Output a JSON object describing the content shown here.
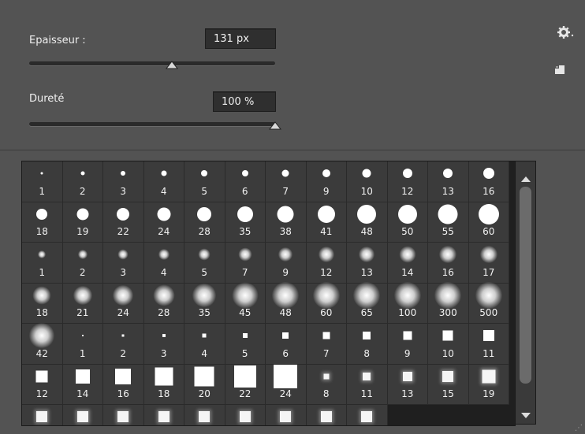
{
  "size": {
    "label": "Epaisseur :",
    "value": "131 px",
    "slider_percent": 58
  },
  "hardness": {
    "label": "Dureté",
    "value": "100 %",
    "slider_percent": 100
  },
  "icons": {
    "settings": "gear-icon",
    "new_preset": "new-preset-icon"
  },
  "brushes": [
    {
      "size": "1",
      "kind": "hard"
    },
    {
      "size": "2",
      "kind": "hard"
    },
    {
      "size": "3",
      "kind": "hard"
    },
    {
      "size": "4",
      "kind": "hard"
    },
    {
      "size": "5",
      "kind": "hard"
    },
    {
      "size": "6",
      "kind": "hard"
    },
    {
      "size": "7",
      "kind": "hard"
    },
    {
      "size": "9",
      "kind": "hard"
    },
    {
      "size": "10",
      "kind": "hard"
    },
    {
      "size": "12",
      "kind": "hard"
    },
    {
      "size": "13",
      "kind": "hard"
    },
    {
      "size": "16",
      "kind": "hard"
    },
    {
      "size": "18",
      "kind": "hard"
    },
    {
      "size": "19",
      "kind": "hard"
    },
    {
      "size": "22",
      "kind": "hard"
    },
    {
      "size": "24",
      "kind": "hard"
    },
    {
      "size": "28",
      "kind": "hard"
    },
    {
      "size": "35",
      "kind": "hard"
    },
    {
      "size": "38",
      "kind": "hard"
    },
    {
      "size": "41",
      "kind": "hard"
    },
    {
      "size": "48",
      "kind": "hard"
    },
    {
      "size": "50",
      "kind": "hard"
    },
    {
      "size": "55",
      "kind": "hard"
    },
    {
      "size": "60",
      "kind": "hard"
    },
    {
      "size": "1",
      "kind": "soft"
    },
    {
      "size": "2",
      "kind": "soft"
    },
    {
      "size": "3",
      "kind": "soft"
    },
    {
      "size": "4",
      "kind": "soft"
    },
    {
      "size": "5",
      "kind": "soft"
    },
    {
      "size": "7",
      "kind": "soft"
    },
    {
      "size": "9",
      "kind": "soft"
    },
    {
      "size": "12",
      "kind": "soft"
    },
    {
      "size": "13",
      "kind": "soft"
    },
    {
      "size": "14",
      "kind": "soft"
    },
    {
      "size": "16",
      "kind": "soft"
    },
    {
      "size": "17",
      "kind": "soft"
    },
    {
      "size": "18",
      "kind": "soft"
    },
    {
      "size": "21",
      "kind": "soft"
    },
    {
      "size": "24",
      "kind": "soft"
    },
    {
      "size": "28",
      "kind": "soft"
    },
    {
      "size": "35",
      "kind": "soft"
    },
    {
      "size": "45",
      "kind": "soft"
    },
    {
      "size": "48",
      "kind": "soft"
    },
    {
      "size": "60",
      "kind": "soft"
    },
    {
      "size": "65",
      "kind": "soft"
    },
    {
      "size": "100",
      "kind": "soft"
    },
    {
      "size": "300",
      "kind": "soft"
    },
    {
      "size": "500",
      "kind": "soft"
    },
    {
      "size": "42",
      "kind": "soft"
    },
    {
      "size": "1",
      "kind": "square"
    },
    {
      "size": "2",
      "kind": "square"
    },
    {
      "size": "3",
      "kind": "square"
    },
    {
      "size": "4",
      "kind": "square"
    },
    {
      "size": "5",
      "kind": "square"
    },
    {
      "size": "6",
      "kind": "square"
    },
    {
      "size": "7",
      "kind": "square"
    },
    {
      "size": "8",
      "kind": "square"
    },
    {
      "size": "9",
      "kind": "square"
    },
    {
      "size": "10",
      "kind": "square"
    },
    {
      "size": "11",
      "kind": "square"
    },
    {
      "size": "12",
      "kind": "square"
    },
    {
      "size": "14",
      "kind": "square"
    },
    {
      "size": "16",
      "kind": "square"
    },
    {
      "size": "18",
      "kind": "square"
    },
    {
      "size": "20",
      "kind": "square"
    },
    {
      "size": "22",
      "kind": "square"
    },
    {
      "size": "24",
      "kind": "square"
    },
    {
      "size": "8",
      "kind": "softsquare"
    },
    {
      "size": "11",
      "kind": "softsquare"
    },
    {
      "size": "13",
      "kind": "softsquare"
    },
    {
      "size": "15",
      "kind": "softsquare"
    },
    {
      "size": "19",
      "kind": "softsquare"
    },
    {
      "size": "",
      "kind": "softsquare"
    },
    {
      "size": "",
      "kind": "softsquare"
    },
    {
      "size": "",
      "kind": "softsquare"
    },
    {
      "size": "",
      "kind": "softsquare"
    },
    {
      "size": "",
      "kind": "softsquare"
    },
    {
      "size": "",
      "kind": "softsquare"
    },
    {
      "size": "",
      "kind": "softsquare"
    },
    {
      "size": "",
      "kind": "softsquare"
    },
    {
      "size": "",
      "kind": "softsquare"
    }
  ]
}
